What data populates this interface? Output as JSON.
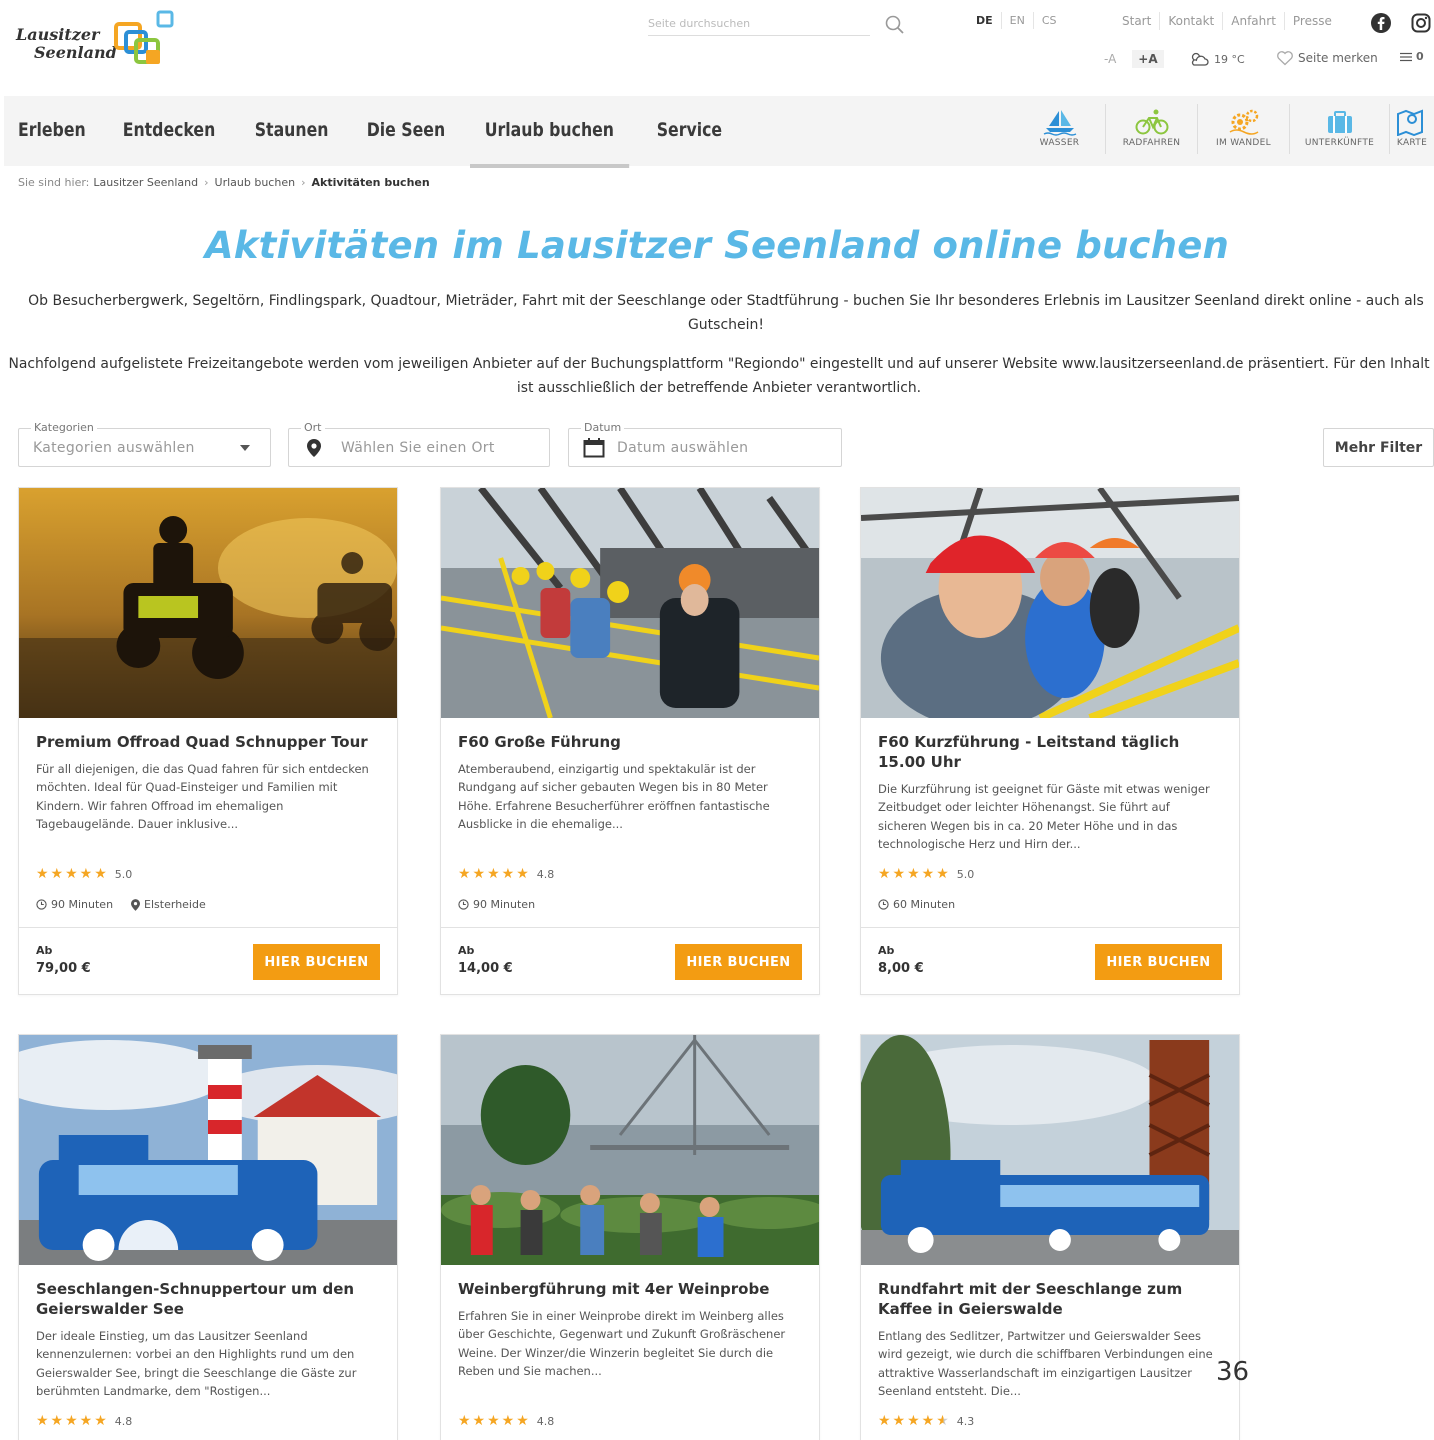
{
  "header": {
    "logo_line1": "Lausitzer",
    "logo_line2": "Seenland",
    "search_placeholder": "Seite durchsuchen",
    "languages": [
      "DE",
      "EN",
      "CS"
    ],
    "top_links": [
      "Start",
      "Kontakt",
      "Anfahrt",
      "Presse"
    ],
    "font_smaller": "-A",
    "font_larger": "+A",
    "weather": "19 °C",
    "bookmark_label": "Seite merken",
    "bookmark_count": "0"
  },
  "nav": {
    "items": [
      "Erleben",
      "Entdecken",
      "Staunen",
      "Die Seen",
      "Urlaub buchen",
      "Service"
    ],
    "active_index": 4,
    "quicklinks": [
      "WASSER",
      "RADFAHREN",
      "IM WANDEL",
      "UNTERKÜNFTE",
      "KARTE"
    ]
  },
  "breadcrumb": {
    "prefix": "Sie sind hier:",
    "items": [
      "Lausitzer Seenland",
      "Urlaub buchen"
    ],
    "current": "Aktivitäten buchen"
  },
  "page": {
    "title": "Aktivitäten im Lausitzer Seenland online buchen",
    "intro1": "Ob Besucherbergwerk, Segeltörn, Findlingspark, Quadtour, Mieträder, Fahrt mit der Seeschlange oder Stadtführung - buchen Sie Ihr besonderes Erlebnis im Lausitzer Seenland direkt online - auch als Gutschein!",
    "intro2": "Nachfolgend aufgelistete Freizeitangebote werden vom jeweiligen Anbieter auf der Buchungsplattform \"Regiondo\" eingestellt und auf unserer Website www.lausitzerseenland.de präsentiert. Für den Inhalt ist ausschließlich der betreffende Anbieter verantwortlich."
  },
  "filters": {
    "category_label": "Kategorien",
    "category_value": "Kategorien auswählen",
    "place_label": "Ort",
    "place_value": "Wählen Sie einen Ort",
    "date_label": "Datum",
    "date_value": "Datum auswählen",
    "more_button": "Mehr Filter"
  },
  "cards": [
    {
      "title": "Premium Offroad Quad Schnupper Tour",
      "description": "Für all diejenigen, die das Quad fahren für sich entdecken möchten. Ideal für Quad-Einsteiger und Familien mit Kindern. Wir fahren Offroad im ehemaligen Tagebaugelände. Dauer inklusive...",
      "stars": 5,
      "rating": "5.0",
      "duration": "90 Minuten",
      "location": "Elsterheide",
      "price_prefix": "Ab",
      "price": "79,00 €",
      "button": "HIER BUCHEN"
    },
    {
      "title": "F60 Große Führung",
      "description": "Atemberaubend, einzigartig und spektakulär ist der Rundgang auf sicher gebauten Wegen bis in 80 Meter Höhe. Erfahrene Besucherführer eröffnen fantastische Ausblicke in die ehemalige...",
      "stars": 5,
      "rating": "4.8",
      "duration": "90 Minuten",
      "location": "",
      "price_prefix": "Ab",
      "price": "14,00 €",
      "button": "HIER BUCHEN"
    },
    {
      "title": "F60 Kurzführung - Leitstand täglich 15.00 Uhr",
      "description": "Die Kurzführung ist geeignet für Gäste mit etwas weniger Zeitbudget oder leichter Höhenangst. Sie führt auf sicheren Wegen bis in ca. 20 Meter Höhe und in das technologische Herz und Hirn der...",
      "stars": 5,
      "rating": "5.0",
      "duration": "60 Minuten",
      "location": "",
      "price_prefix": "Ab",
      "price": "8,00 €",
      "button": "HIER BUCHEN"
    },
    {
      "title": "Seeschlangen-Schnuppertour um den Geierswalder See",
      "description": "Der ideale Einstieg, um das Lausitzer Seenland kennenzulernen: vorbei an den Highlights rund um den Geierswalder See, bringt die Seeschlange die Gäste zur berühmten Landmarke, dem \"Rostigen...",
      "stars": 5,
      "rating": "4.8"
    },
    {
      "title": "Weinbergführung mit 4er Weinprobe",
      "description": "Erfahren Sie in einer Weinprobe direkt im Weinberg alles über Geschichte, Gegenwart und Zukunft Großräschener Weine. Der Winzer/die Winzerin begleitet Sie durch die Reben und Sie machen...",
      "stars": 5,
      "rating": "4.8"
    },
    {
      "title": "Rundfahrt mit der Seeschlange zum Kaffee in Geierswalde",
      "description": "Entlang des Sedlitzer, Partwitzer und Geierswalder Sees wird gezeigt, wie durch die schiffbaren Verbindungen eine attraktive Wasserlandschaft im einzigartigen Lausitzer Seenland entsteht. Die...",
      "stars": 4.5,
      "rating": "4.3"
    }
  ],
  "page_number": "36",
  "colors": {
    "accent": "#5ab8e6",
    "button": "#f39c12",
    "stars": "#f5a623"
  }
}
